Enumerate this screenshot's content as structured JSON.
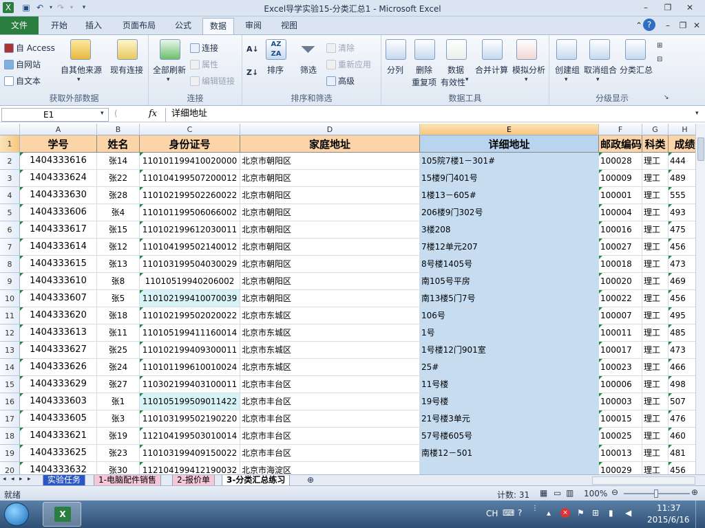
{
  "window": {
    "title": "Excel导学实验15-分类汇总1  -  Microsoft Excel"
  },
  "ribbon_tabs": [
    "文件",
    "开始",
    "插入",
    "页面布局",
    "公式",
    "数据",
    "审阅",
    "视图"
  ],
  "ribbon": {
    "get_external": {
      "access": "自 Access",
      "web": "自网站",
      "text": "自文本",
      "other": "自其他来源",
      "existing": "现有连接",
      "label": "获取外部数据"
    },
    "connections": {
      "refresh": "全部刷新",
      "connect": "连接",
      "props": "属性",
      "edit_links": "编辑链接",
      "label": "连接"
    },
    "sort_filter": {
      "sort": "排序",
      "filter": "筛选",
      "clear": "清除",
      "reapply": "重新应用",
      "advanced": "高级",
      "label": "排序和筛选"
    },
    "data_tools": {
      "split": "分列",
      "remove_dup_1": "删除",
      "remove_dup_2": "重复项",
      "validation_1": "数据",
      "validation_2": "有效性",
      "consolidate": "合并计算",
      "whatif": "模拟分析",
      "label": "数据工具"
    },
    "outline": {
      "group": "创建组",
      "ungroup": "取消组合",
      "subtotal": "分类汇总",
      "label": "分级显示"
    }
  },
  "formula_bar": {
    "name_box": "E1",
    "fx": "fx",
    "content": "详细地址"
  },
  "columns": [
    "A",
    "B",
    "C",
    "D",
    "E",
    "F",
    "G",
    "H"
  ],
  "headers": [
    "学号",
    "姓名",
    "身份证号",
    "家庭地址",
    "详细地址",
    "邮政编码",
    "科类",
    "成绩"
  ],
  "rows": [
    {
      "n": "1",
      "c": [
        "",
        "",
        "",
        "",
        "",
        "",
        "",
        ""
      ]
    },
    {
      "n": "2",
      "c": [
        "1404333616",
        "张14",
        "110101199410020000",
        "北京市朝阳区",
        "105院7楼1－301#",
        "100028",
        "理工",
        "444"
      ]
    },
    {
      "n": "3",
      "c": [
        "1404333624",
        "张22",
        "110104199507200012",
        "北京市朝阳区",
        "15楼9门401号",
        "100009",
        "理工",
        "489"
      ]
    },
    {
      "n": "4",
      "c": [
        "1404333630",
        "张28",
        "110102199502260022",
        "北京市朝阳区",
        "1楼13－605#",
        "100001",
        "理工",
        "555"
      ]
    },
    {
      "n": "5",
      "c": [
        "1404333606",
        "张4",
        "110101199506066002",
        "北京市朝阳区",
        "206楼9门302号",
        "100004",
        "理工",
        "493"
      ]
    },
    {
      "n": "6",
      "c": [
        "1404333617",
        "张15",
        "110102199612030011",
        "北京市朝阳区",
        "3楼208",
        "100016",
        "理工",
        "475"
      ]
    },
    {
      "n": "7",
      "c": [
        "1404333614",
        "张12",
        "110104199502140012",
        "北京市朝阳区",
        "7楼12单元207",
        "100027",
        "理工",
        "456"
      ]
    },
    {
      "n": "8",
      "c": [
        "1404333615",
        "张13",
        "110103199504030029",
        "北京市朝阳区",
        "8号楼1405号",
        "100018",
        "理工",
        "473"
      ]
    },
    {
      "n": "9",
      "c": [
        "1404333610",
        "张8",
        "11010519940206002",
        "北京市朝阳区",
        "南105号平房",
        "100020",
        "理工",
        "469"
      ]
    },
    {
      "n": "10",
      "c": [
        "1404333607",
        "张5",
        "110102199410070039",
        "北京市朝阳区",
        "南13楼5门7号",
        "100022",
        "理工",
        "456"
      ]
    },
    {
      "n": "11",
      "c": [
        "1404333620",
        "张18",
        "110102199502020022",
        "北京市东城区",
        "106号",
        "100007",
        "理工",
        "495"
      ]
    },
    {
      "n": "12",
      "c": [
        "1404333613",
        "张11",
        "110105199411160014",
        "北京市东城区",
        "1号",
        "100011",
        "理工",
        "485"
      ]
    },
    {
      "n": "13",
      "c": [
        "1404333627",
        "张25",
        "110102199409300011",
        "北京市东城区",
        "1号楼12门901室",
        "100017",
        "理工",
        "473"
      ]
    },
    {
      "n": "14",
      "c": [
        "1404333626",
        "张24",
        "110101199610010024",
        "北京市东城区",
        "25#",
        "100023",
        "理工",
        "466"
      ]
    },
    {
      "n": "15",
      "c": [
        "1404333629",
        "张27",
        "110302199403100011",
        "北京市丰台区",
        "11号楼",
        "100006",
        "理工",
        "498"
      ]
    },
    {
      "n": "16",
      "c": [
        "1404333603",
        "张1",
        "110105199509011422",
        "北京市丰台区",
        "19号楼",
        "100003",
        "理工",
        "507"
      ]
    },
    {
      "n": "17",
      "c": [
        "1404333605",
        "张3",
        "110103199502190220",
        "北京市丰台区",
        "21号楼3单元",
        "100015",
        "理工",
        "476"
      ]
    },
    {
      "n": "18",
      "c": [
        "1404333621",
        "张19",
        "112104199503010014",
        "北京市丰台区",
        "57号楼605号",
        "100025",
        "理工",
        "460"
      ]
    },
    {
      "n": "19",
      "c": [
        "1404333625",
        "张23",
        "110103199409150022",
        "北京市丰台区",
        "南楼12－501",
        "100013",
        "理工",
        "481"
      ]
    },
    {
      "n": "20",
      "c": [
        "1404333632",
        "张30",
        "112104199412190032",
        "北京市海淀区",
        "",
        "100029",
        "理工",
        "456"
      ]
    }
  ],
  "sheet_tabs": [
    "实验任务",
    "1-电脑配件销售",
    "2-报价单",
    "3-分类汇总练习"
  ],
  "status": {
    "mode": "就绪",
    "count": "计数: 31",
    "zoom": "100%"
  },
  "taskbar": {
    "ime": "CH",
    "time": "11:37",
    "date": "2015/6/16"
  }
}
